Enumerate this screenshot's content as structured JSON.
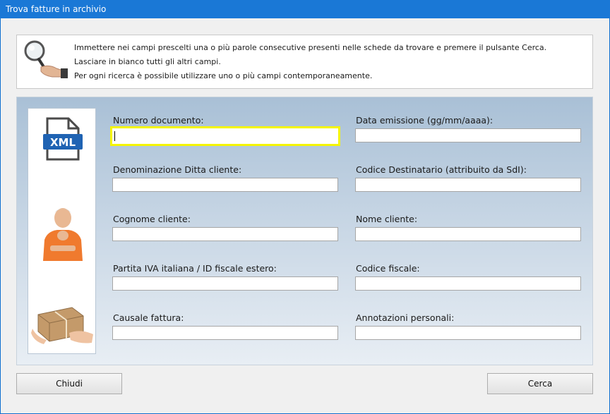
{
  "window": {
    "title": "Trova fatture in archivio"
  },
  "info": {
    "lines": [
      "Immettere nei campi prescelti una o più parole consecutive presenti nelle schede da trovare e premere il pulsante Cerca.",
      "Lasciare in bianco tutti gli altri campi.",
      "Per ogni ricerca è possibile utilizzare uno o più campi contemporaneamente."
    ]
  },
  "icons": {
    "xml_text": "XML"
  },
  "fields": {
    "numero_documento": {
      "label": "Numero documento:",
      "value": ""
    },
    "data_emissione": {
      "label": "Data emissione (gg/mm/aaaa):",
      "value": ""
    },
    "denominazione": {
      "label": "Denominazione Ditta cliente:",
      "value": ""
    },
    "codice_destinatario": {
      "label": "Codice Destinatario (attribuito da SdI):",
      "value": ""
    },
    "cognome": {
      "label": "Cognome cliente:",
      "value": ""
    },
    "nome": {
      "label": "Nome cliente:",
      "value": ""
    },
    "partita_iva": {
      "label": "Partita IVA italiana / ID fiscale estero:",
      "value": ""
    },
    "codice_fiscale": {
      "label": "Codice fiscale:",
      "value": ""
    },
    "causale": {
      "label": "Causale fattura:",
      "value": ""
    },
    "annotazioni": {
      "label": "Annotazioni personali:",
      "value": ""
    }
  },
  "buttons": {
    "close": "Chiudi",
    "search": "Cerca"
  },
  "colors": {
    "titlebar": "#1a78d6",
    "focus": "#f5f500"
  }
}
